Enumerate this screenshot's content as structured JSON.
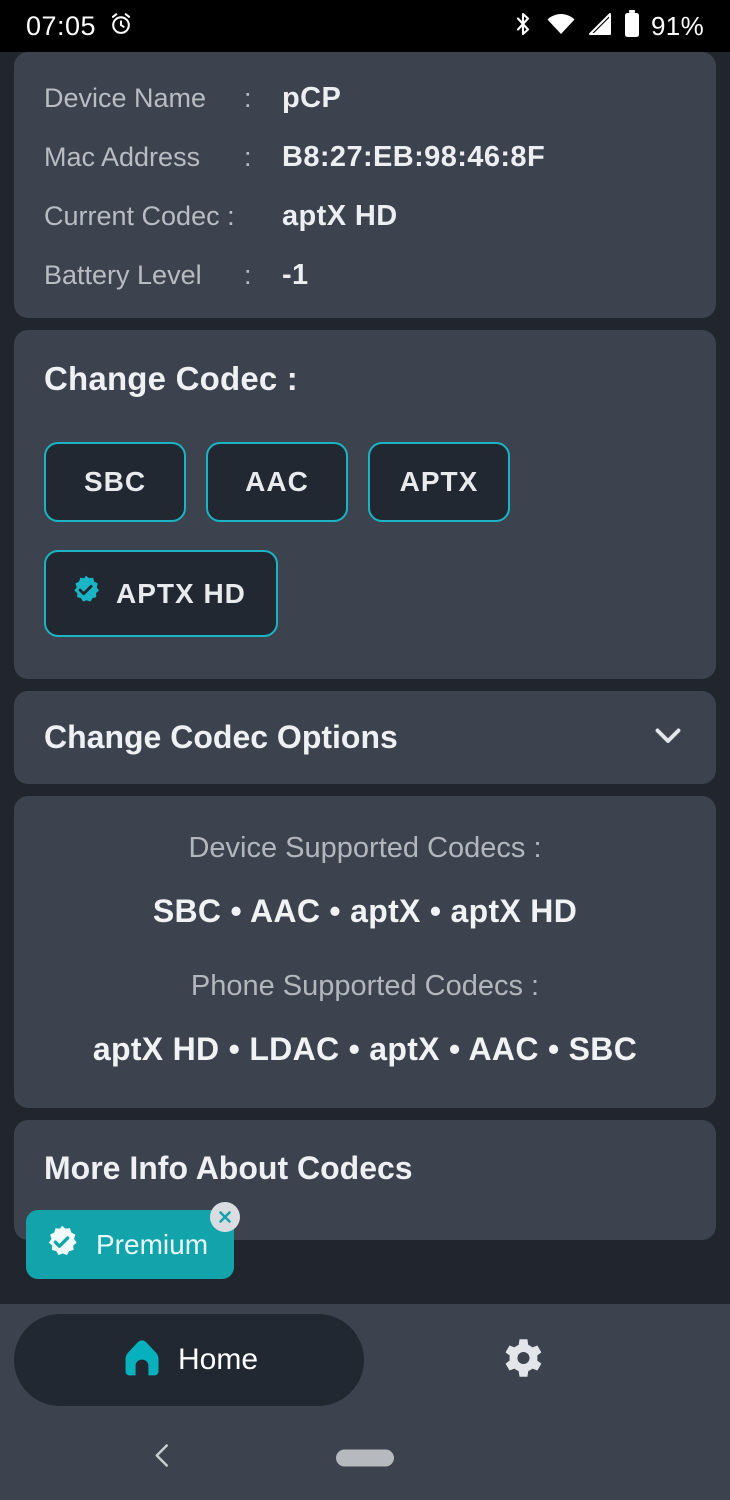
{
  "status_bar": {
    "time": "07:05",
    "alarm_icon": "alarm-icon",
    "bluetooth_icon": "bluetooth-icon",
    "wifi_icon": "wifi-icon",
    "signal_icon": "cellular-signal-icon",
    "battery_icon": "battery-icon",
    "battery_percent": "91%"
  },
  "device_info": {
    "rows": [
      {
        "label": "Device Name",
        "colon": ":",
        "value": "pCP"
      },
      {
        "label": "Mac Address",
        "colon": ":",
        "value": "B8:27:EB:98:46:8F"
      },
      {
        "label": "Current Codec :",
        "colon": "",
        "value": "aptX HD"
      },
      {
        "label": "Battery Level",
        "colon": ":",
        "value": "-1"
      }
    ]
  },
  "change_codec": {
    "title": "Change Codec :",
    "buttons": [
      {
        "label": "SBC",
        "selected": false
      },
      {
        "label": "AAC",
        "selected": false
      },
      {
        "label": "APTX",
        "selected": false
      },
      {
        "label": "APTX HD",
        "selected": true
      }
    ],
    "selected_icon": "verified-badge-icon"
  },
  "codec_options": {
    "label": "Change Codec Options",
    "expander_icon": "chevron-down-icon"
  },
  "supported": {
    "device_label": "Device Supported Codecs :",
    "device_value": "SBC • AAC • aptX • aptX HD",
    "phone_label": "Phone Supported Codecs :",
    "phone_value": "aptX HD • LDAC • aptX • AAC • SBC"
  },
  "more_info": {
    "title": "More Info About Codecs"
  },
  "premium": {
    "label": "Premium",
    "badge_icon": "verified-badge-icon",
    "close_icon": "close-icon"
  },
  "bottom_nav": {
    "home_label": "Home",
    "home_icon": "home-icon",
    "settings_icon": "gear-icon"
  },
  "system_nav": {
    "back_icon": "back-chevron-icon",
    "home_indicator": "home-pill-indicator"
  },
  "colors": {
    "page_background": "#21262e",
    "card_background": "#3c424e",
    "accent_teal": "#1ab5c4",
    "premium_teal": "#13a3ab",
    "button_fill": "#212831",
    "label_gray": "#b3b7bd",
    "value_white": "#eef0f3"
  }
}
